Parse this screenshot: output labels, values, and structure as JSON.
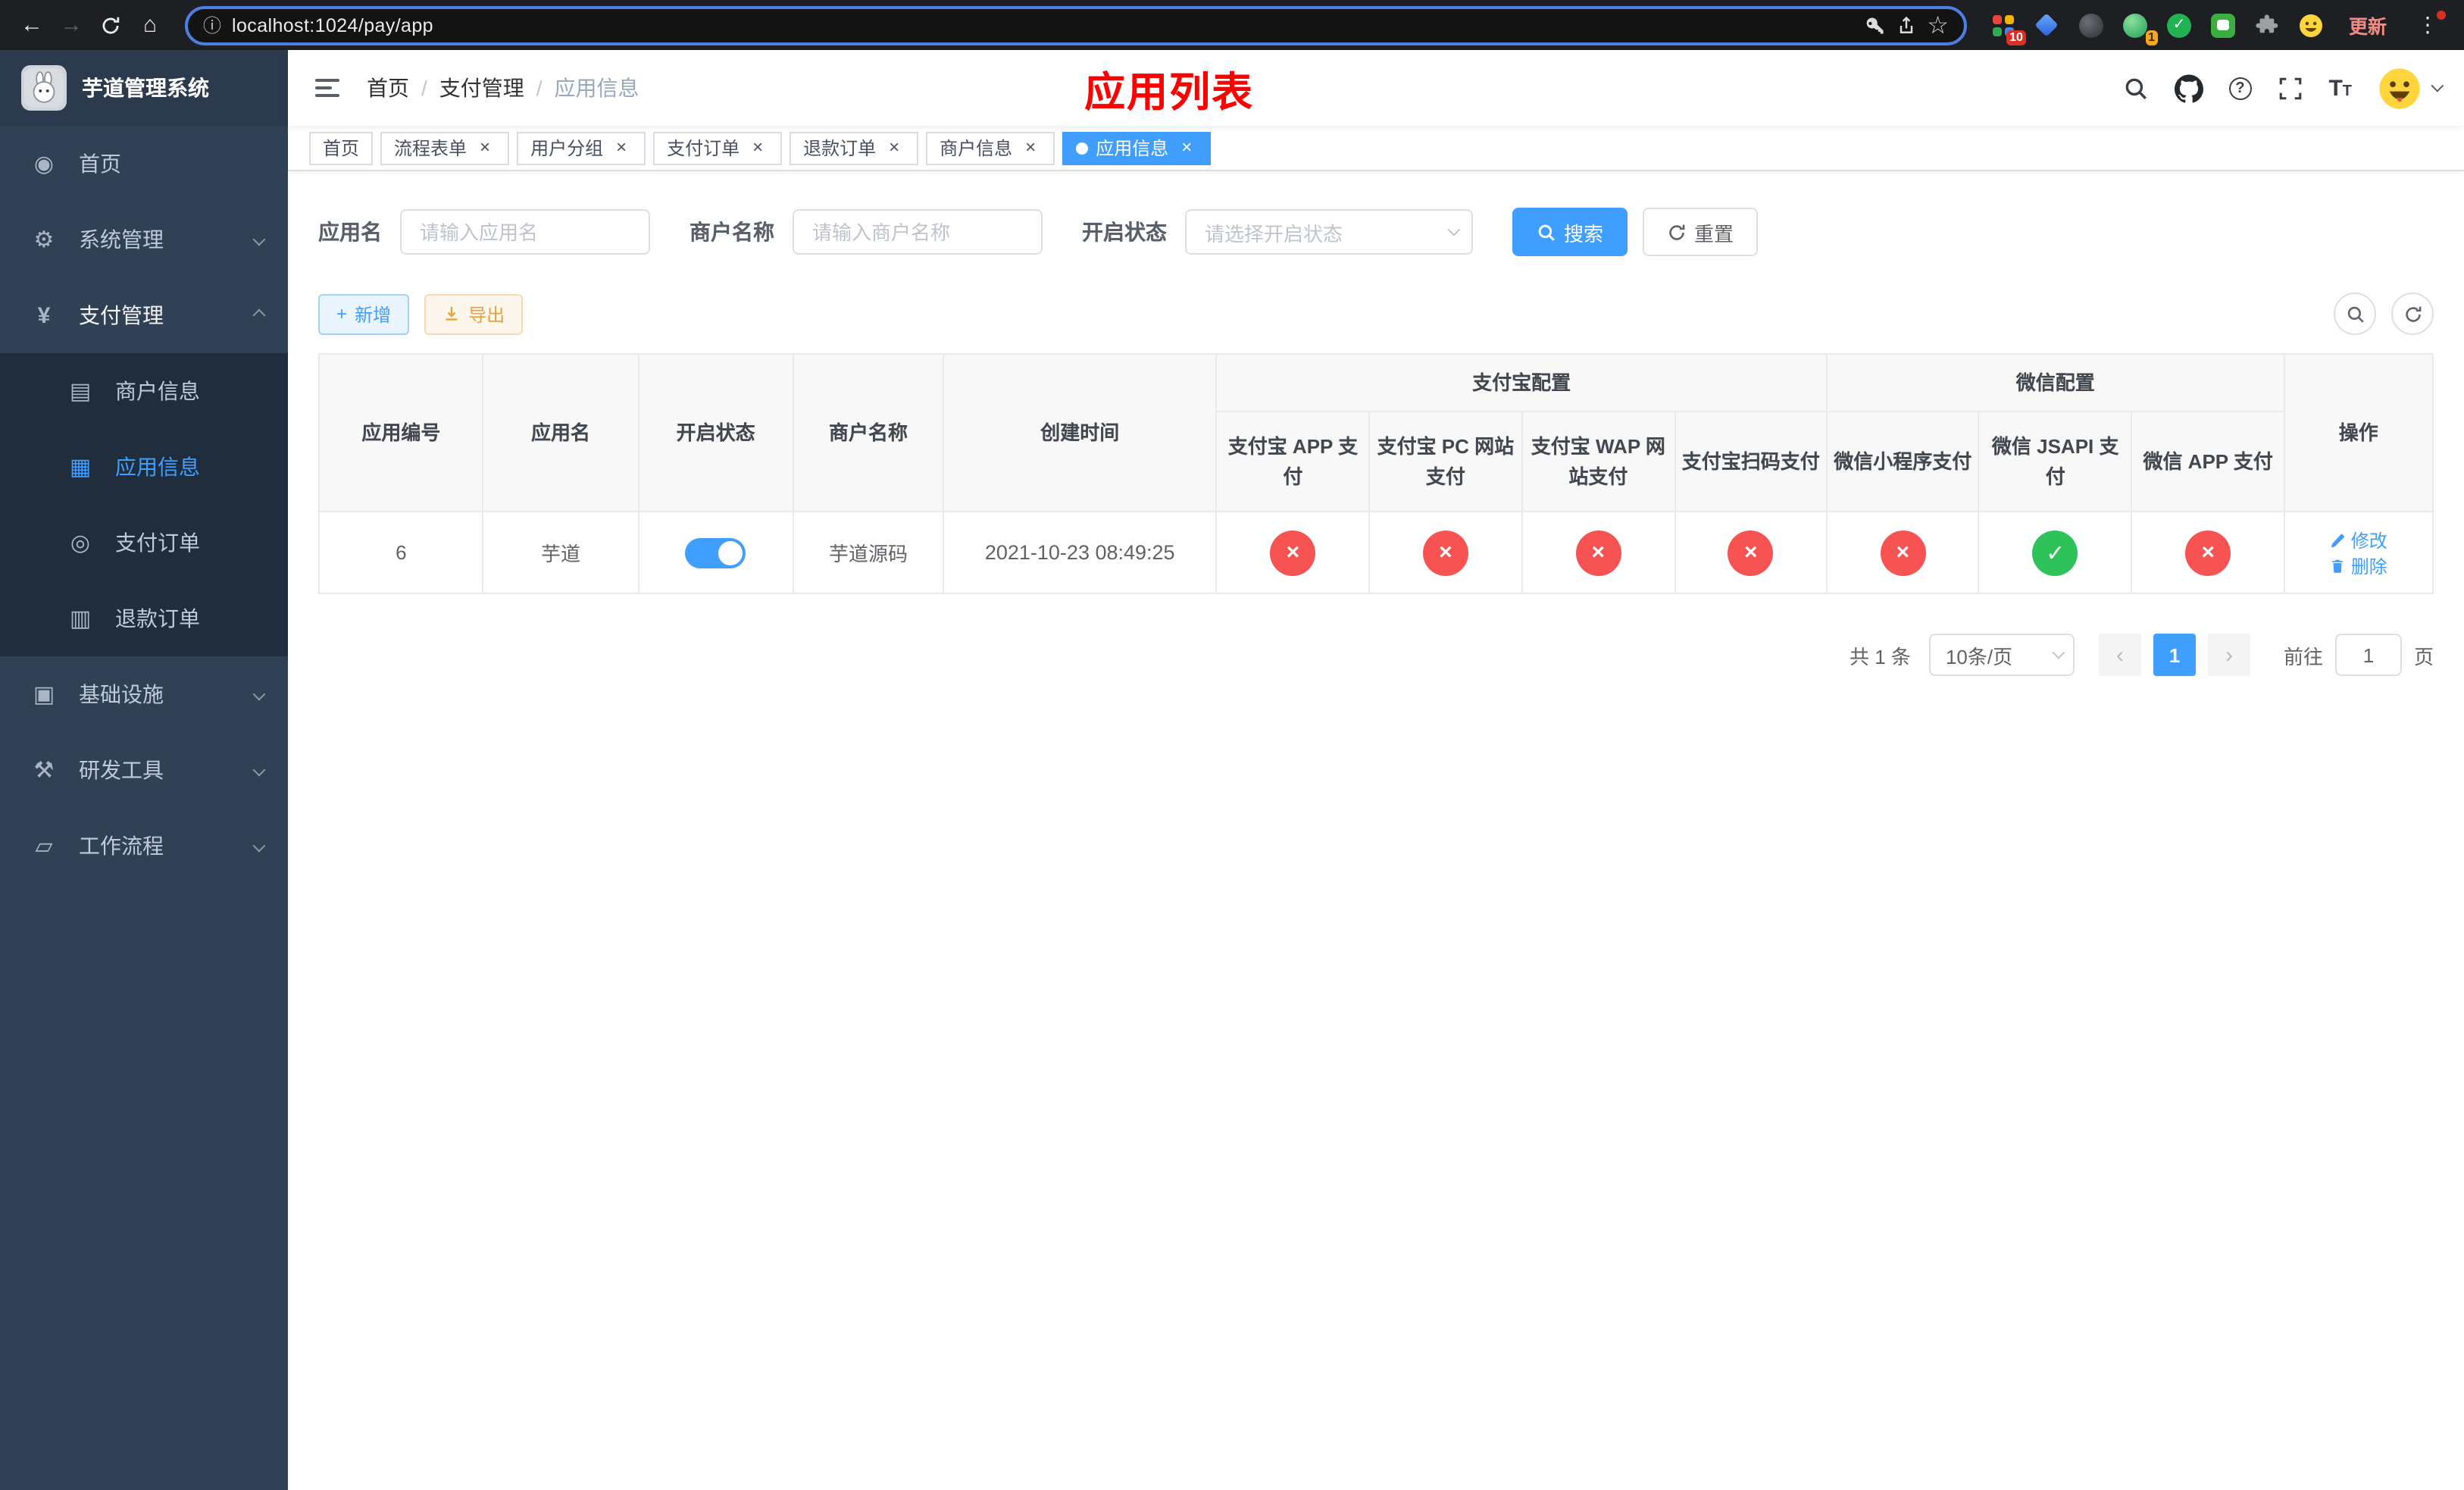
{
  "browser": {
    "url": "localhost:1024/pay/app",
    "update_label": "更新",
    "ext_grid_badge": "10",
    "ext_avatar_badge": "1"
  },
  "sidebar": {
    "logo_title": "芋道管理系统",
    "items": [
      {
        "label": "首页",
        "icon": "dashboard-icon"
      },
      {
        "label": "系统管理",
        "icon": "gear-icon"
      },
      {
        "label": "支付管理",
        "icon": "yen-icon"
      },
      {
        "label": "商户信息",
        "icon": "merchant-card-icon"
      },
      {
        "label": "应用信息",
        "icon": "app-grid-icon"
      },
      {
        "label": "支付订单",
        "icon": "pay-order-icon"
      },
      {
        "label": "退款订单",
        "icon": "refund-order-icon"
      },
      {
        "label": "基础设施",
        "icon": "infrastructure-icon"
      },
      {
        "label": "研发工具",
        "icon": "dev-tools-icon"
      },
      {
        "label": "工作流程",
        "icon": "workflow-icon"
      }
    ]
  },
  "navbar": {
    "breadcrumb": [
      "首页",
      "支付管理",
      "应用信息"
    ],
    "page_title": "应用列表"
  },
  "tabs": [
    {
      "label": "首页",
      "closable": false,
      "active": false
    },
    {
      "label": "流程表单",
      "closable": true,
      "active": false
    },
    {
      "label": "用户分组",
      "closable": true,
      "active": false
    },
    {
      "label": "支付订单",
      "closable": true,
      "active": false
    },
    {
      "label": "退款订单",
      "closable": true,
      "active": false
    },
    {
      "label": "商户信息",
      "closable": true,
      "active": false
    },
    {
      "label": "应用信息",
      "closable": true,
      "active": true
    }
  ],
  "filters": {
    "app_name_label": "应用名",
    "app_name_placeholder": "请输入应用名",
    "merchant_label": "商户名称",
    "merchant_placeholder": "请输入商户名称",
    "status_label": "开启状态",
    "status_placeholder": "请选择开启状态",
    "search_button": "搜索",
    "reset_button": "重置"
  },
  "toolbar": {
    "add_button": "新增",
    "export_button": "导出"
  },
  "table": {
    "headers": {
      "app_id": "应用编号",
      "app_name": "应用名",
      "status": "开启状态",
      "merchant": "商户名称",
      "create_time": "创建时间",
      "alipay_group": "支付宝配置",
      "wechat_group": "微信配置",
      "alipay_app": "支付宝 APP 支付",
      "alipay_pc": "支付宝 PC 网站支付",
      "alipay_wap": "支付宝 WAP 网站支付",
      "alipay_qr": "支付宝扫码支付",
      "wechat_lite": "微信小程序支付",
      "wechat_jsapi": "微信 JSAPI 支付",
      "wechat_app": "微信 APP 支付",
      "actions": "操作"
    },
    "rows": [
      {
        "app_id": "6",
        "app_name": "芋道",
        "status_on": true,
        "merchant": "芋道源码",
        "create_time": "2021-10-23 08:49:25",
        "configs": {
          "alipay_app": false,
          "alipay_pc": false,
          "alipay_wap": false,
          "alipay_qr": false,
          "wechat_lite": false,
          "wechat_jsapi": true,
          "wechat_app": false
        },
        "edit_label": "修改",
        "delete_label": "删除"
      }
    ]
  },
  "pagination": {
    "total_text": "共 1 条",
    "page_size_label": "10条/页",
    "current_page": "1",
    "goto_label": "前往",
    "goto_value": "1",
    "page_suffix": "页"
  },
  "colors": {
    "accent": "#409eff",
    "success": "#2fc25b",
    "danger": "#f75353",
    "warning": "#e6a23c",
    "title_red": "#ff0000",
    "sidebar_bg": "#304156",
    "submenu_bg": "#1f2d3d"
  }
}
